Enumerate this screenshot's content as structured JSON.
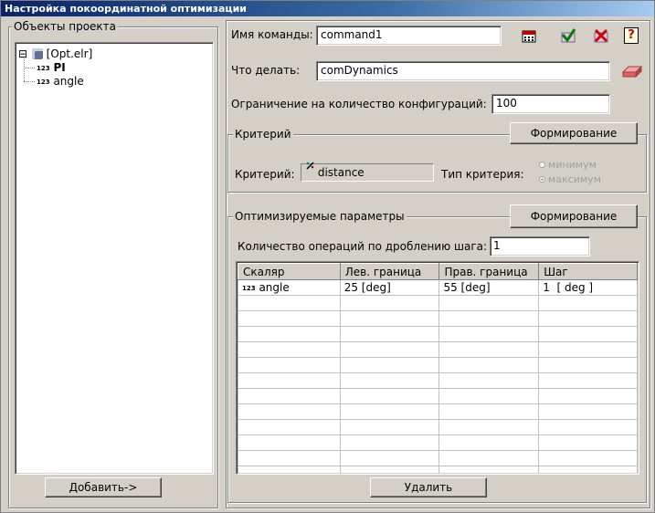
{
  "window": {
    "title": "Настройка покоординатной оптимизации"
  },
  "project_panel": {
    "legend": "Объекты проекта",
    "tree": [
      {
        "icon": "project-icon",
        "label": "[Opt.elr]",
        "expander": "⊟"
      },
      {
        "icon": "123",
        "label": "PI"
      },
      {
        "icon": "123",
        "label": "angle"
      }
    ],
    "add_button": "Добавить->"
  },
  "command": {
    "name_label": "Имя команды:",
    "name_value": "command1",
    "action_label": "Что делать:",
    "action_value": "comDynamics",
    "limit_label": "Ограничение на количество конфигураций:",
    "limit_value": "100"
  },
  "toolbar": {
    "icons": [
      "calculator-icon",
      "check-icon",
      "delete-icon",
      "help-icon"
    ],
    "help_glyph": "?"
  },
  "criterion": {
    "legend": "Критерий",
    "form_button": "Формирование",
    "label": "Критерий:",
    "value": "distance",
    "type_label": "Тип критерия:",
    "options": [
      {
        "label": "минимум",
        "selected": false
      },
      {
        "label": "максимум",
        "selected": true
      }
    ]
  },
  "params": {
    "legend": "Оптимизируемые параметры",
    "form_button": "Формирование",
    "step_label": "Количество операций по дроблению шага:",
    "step_value": "1",
    "columns": [
      "Скаляр",
      "Лев. граница",
      "Прав. граница",
      "Шаг"
    ],
    "rows": [
      {
        "badge": "123",
        "name": "angle",
        "left": "25 [deg]",
        "right": "55 [deg]",
        "step": "1  [ deg ]"
      }
    ],
    "delete_button": "Удалить"
  }
}
